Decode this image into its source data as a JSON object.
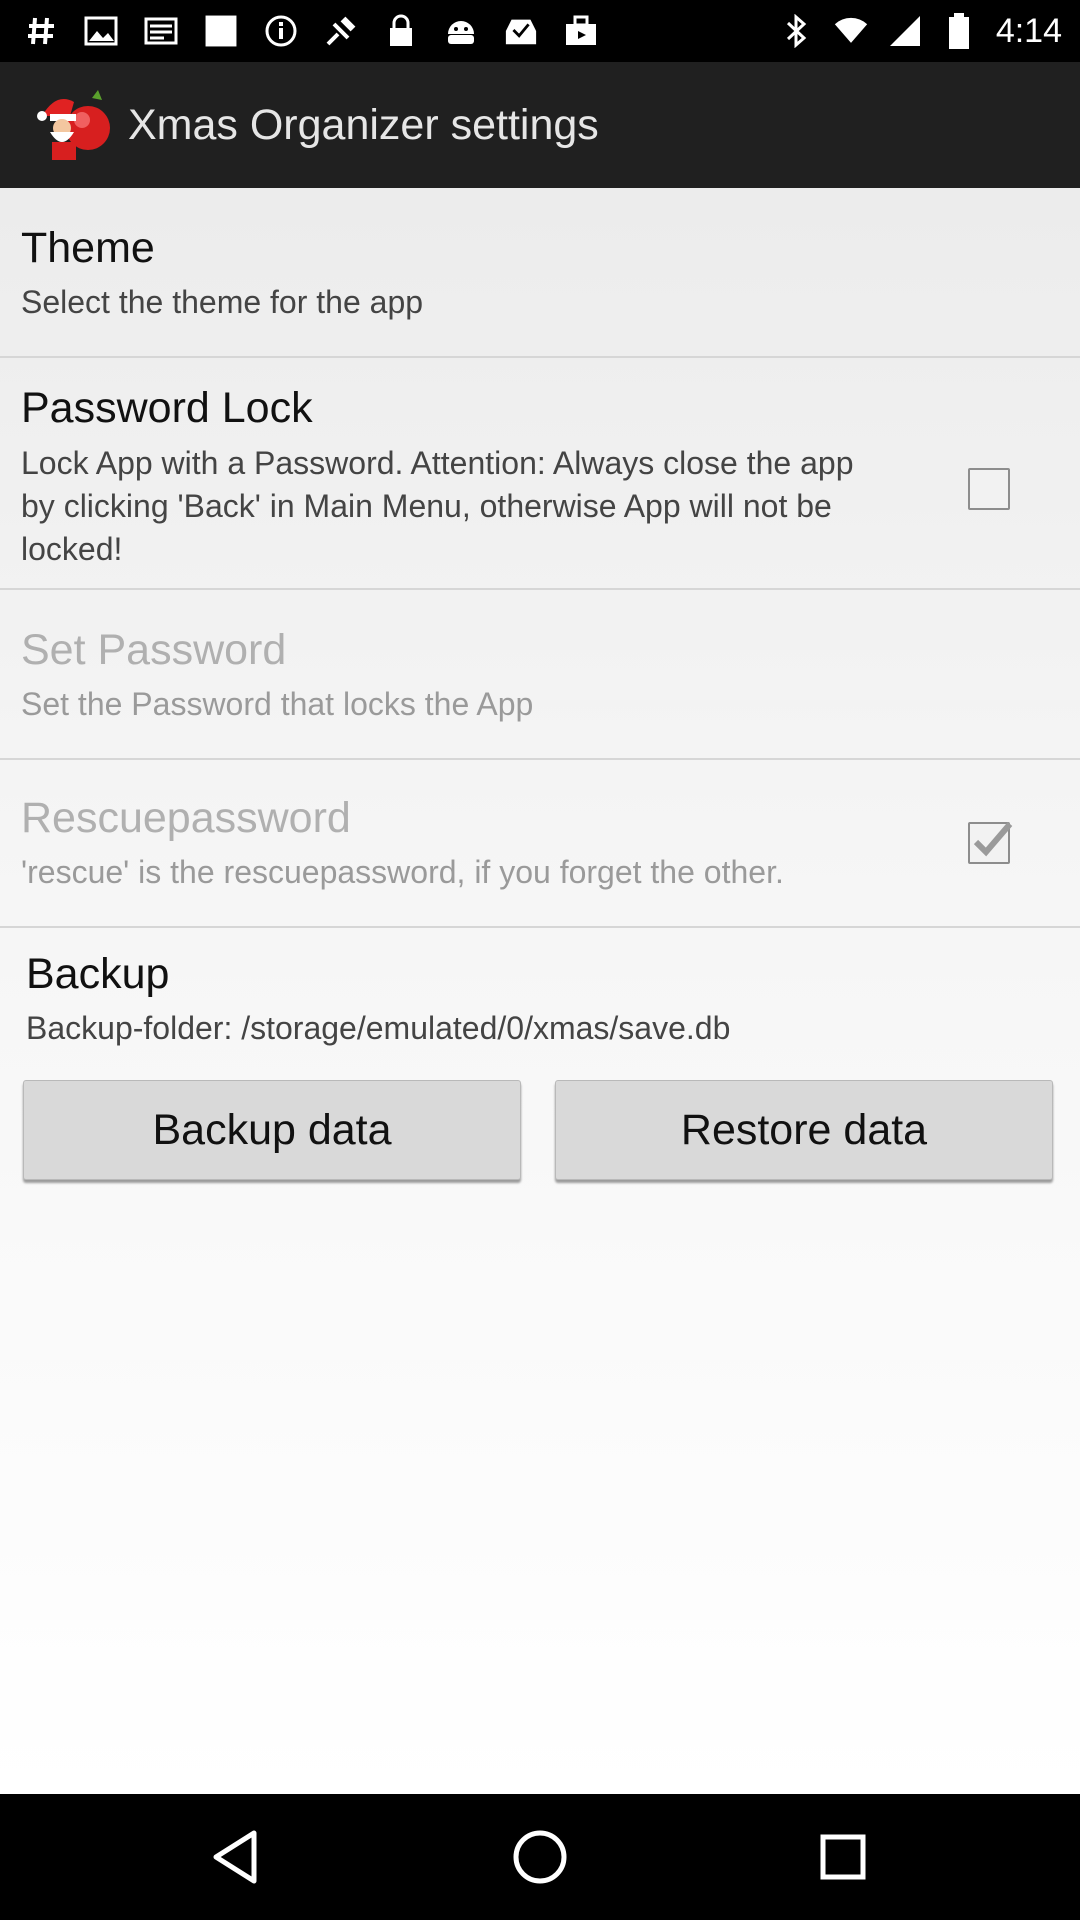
{
  "status_bar": {
    "time": "4:14",
    "left_icons": [
      "hash-icon",
      "image-icon",
      "mail-icon",
      "square-icon",
      "info-icon",
      "fax-satellite-icon",
      "lock-icon",
      "android-icon",
      "inbox-check-icon",
      "briefcase-icon"
    ],
    "right_icons": [
      "bluetooth-icon",
      "wifi-icon",
      "signal-icon",
      "battery-icon"
    ]
  },
  "action_bar": {
    "title": "Xmas Organizer settings",
    "icon": "santa-icon"
  },
  "preferences": [
    {
      "key": "theme",
      "title": "Theme",
      "summary": "Select the theme for the app",
      "enabled": true
    },
    {
      "key": "password_lock",
      "title": "Password Lock",
      "summary": "Lock App with a Password. Attention: Always close the app by clicking 'Back' in Main Menu, otherwise App will not be locked!",
      "enabled": true,
      "checked": false
    },
    {
      "key": "set_password",
      "title": "Set Password",
      "summary": "Set the Password that locks the App",
      "enabled": false
    },
    {
      "key": "rescue_password",
      "title": "Rescuepassword",
      "summary": "'rescue' is the rescuepassword, if you forget the other.",
      "enabled": false,
      "checked": true
    }
  ],
  "backup": {
    "title": "Backup",
    "folder": "Backup-folder: /storage/emulated/0/xmas/save.db",
    "backup_button": "Backup data",
    "restore_button": "Restore data"
  },
  "nav_bar": {
    "icons": [
      "back-icon",
      "home-icon",
      "recents-icon"
    ]
  },
  "colors": {
    "action_bar": "#202020",
    "content_bg": "#ececec",
    "button_bg": "#d9d9d9"
  }
}
